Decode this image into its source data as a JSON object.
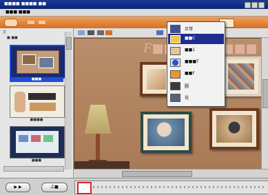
{
  "window": {
    "title": "■■■■ ■■■■ ■■",
    "menu_label": "■■■ ■■■"
  },
  "left_panel": {
    "label": "文",
    "sublabel": "■ ■■",
    "thumbnails": [
      {
        "caption": "■■■"
      },
      {
        "caption": "■■■■"
      },
      {
        "caption": "■■■"
      }
    ]
  },
  "stage": {
    "title_text": "F■■■■■■■■■ on"
  },
  "dropdown": {
    "items": [
      {
        "label": "正常",
        "icon": "normal-icon",
        "selected": false
      },
      {
        "label": "■■C",
        "icon": "yellow-frame-icon",
        "selected": true
      },
      {
        "label": "■■1",
        "icon": "frame-icon",
        "selected": false
      },
      {
        "label": "■■■T",
        "icon": "blue-circle-icon",
        "selected": false
      },
      {
        "label": "■■F",
        "icon": "orange-icon",
        "selected": false
      },
      {
        "label": "圖",
        "icon": "dark-icon",
        "selected": false
      },
      {
        "label": "花",
        "icon": "flower-icon",
        "selected": false
      }
    ]
  },
  "bottom": {
    "left_button": "▶ ▶",
    "right_button": "上■"
  },
  "colors": {
    "accent_orange": "#d66f26",
    "menu_selected": "#1e2d8f",
    "selected_caption_bg": "#1d4fd6"
  }
}
